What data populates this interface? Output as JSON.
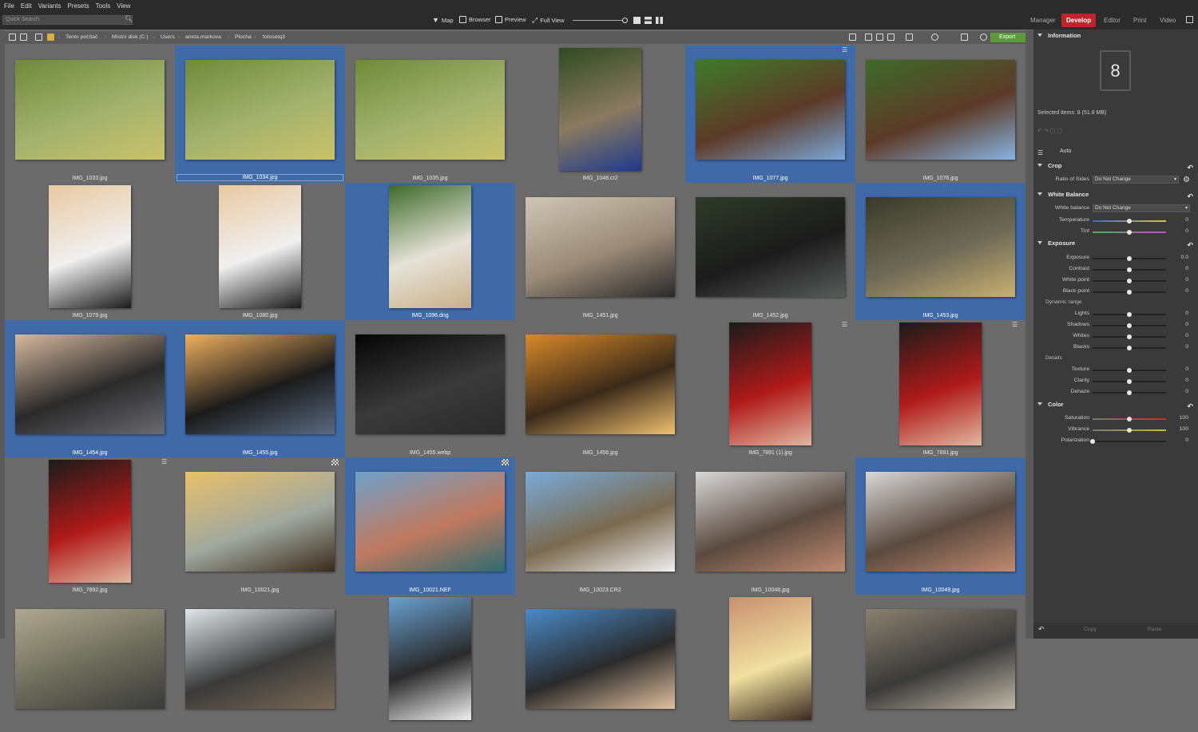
{
  "menu": [
    "File",
    "Edit",
    "Variants",
    "Presets",
    "Tools",
    "View"
  ],
  "search": {
    "placeholder": "Quick Search"
  },
  "view_tabs": [
    {
      "label": "Map",
      "icon": "map-pin-icon"
    },
    {
      "label": "Browser",
      "icon": "folder-icon"
    },
    {
      "label": "Preview",
      "icon": "image-icon"
    },
    {
      "label": "Full View",
      "icon": "expand-icon"
    }
  ],
  "mode_tabs": [
    "Manager",
    "Develop",
    "Editor",
    "Print",
    "Video"
  ],
  "active_mode": "Develop",
  "breadcrumb": [
    "Tento počítač",
    "Místní disk (C:)",
    "Users",
    "aneta.markova",
    "Plocha",
    "fotosetq3"
  ],
  "export_label": "Export",
  "colors": {
    "accent": "#b8282a",
    "selection": "#3f6aa7",
    "export": "#5c9a3c"
  },
  "thumbnails": [
    {
      "name": "IMG_1033.jpg",
      "selected": false,
      "orient": "land",
      "palette": [
        "#6f8a3a",
        "#c9c36a",
        "#a3b26e"
      ]
    },
    {
      "name": "IMG_1034.jpg",
      "selected": true,
      "focused": true,
      "orient": "land",
      "palette": [
        "#6f8a3a",
        "#c9c36a",
        "#a3b26e"
      ]
    },
    {
      "name": "IMG_1035.jpg",
      "selected": false,
      "orient": "land",
      "palette": [
        "#6f8a3a",
        "#c9c36a",
        "#a3b26e"
      ]
    },
    {
      "name": "IMG_1048.cr2",
      "selected": false,
      "orient": "port",
      "palette": [
        "#2f4a22",
        "#1f3a8a",
        "#8a7a60"
      ]
    },
    {
      "name": "IMG_1077.jpg",
      "selected": true,
      "orient": "land",
      "palette": [
        "#3f7a2a",
        "#7ba8d8",
        "#5c3a28"
      ],
      "badge": "menu"
    },
    {
      "name": "IMG_1078.jpg",
      "selected": false,
      "orient": "land",
      "palette": [
        "#3f6a2a",
        "#87b4e0",
        "#5c3a28"
      ]
    },
    {
      "name": "IMG_1079.jpg",
      "selected": false,
      "orient": "port",
      "palette": [
        "#e8c9a0",
        "#1b1b1b",
        "#f0f0f0"
      ]
    },
    {
      "name": "IMG_1080.jpg",
      "selected": false,
      "orient": "port",
      "palette": [
        "#e8c9a0",
        "#1b1b1b",
        "#f0f0f0"
      ]
    },
    {
      "name": "IMG_1096.dng",
      "selected": true,
      "orient": "port",
      "palette": [
        "#3d6a2a",
        "#c8b08a",
        "#e6e2d8"
      ]
    },
    {
      "name": "IMG_1451.jpg",
      "selected": false,
      "orient": "land",
      "palette": [
        "#cfc6b6",
        "#2a2a2a",
        "#9a8a78"
      ]
    },
    {
      "name": "IMG_1452.jpg",
      "selected": false,
      "orient": "land",
      "palette": [
        "#2f3a2a",
        "#595c5a",
        "#1b1b1b"
      ]
    },
    {
      "name": "IMG_1453.jpg",
      "selected": true,
      "orient": "land",
      "palette": [
        "#3a3a2a",
        "#c8b070",
        "#6f6a58"
      ]
    },
    {
      "name": "IMG_1454.jpg",
      "selected": true,
      "orient": "land",
      "palette": [
        "#d6b9a0",
        "#6a6a70",
        "#2a2a2a"
      ]
    },
    {
      "name": "IMG_1455.jpg",
      "selected": true,
      "orient": "land",
      "palette": [
        "#f0b060",
        "#5a6a80",
        "#1b1b1b"
      ]
    },
    {
      "name": "IMG_1455.webp",
      "selected": false,
      "orient": "land",
      "palette": [
        "#050505",
        "#2a2a2a",
        "#3a3a3a"
      ]
    },
    {
      "name": "IMG_1456.jpg",
      "selected": false,
      "orient": "land",
      "palette": [
        "#d88a2a",
        "#f0c070",
        "#3a2a1a"
      ]
    },
    {
      "name": "IMG_7891 (1).jpg",
      "selected": false,
      "orient": "port",
      "palette": [
        "#1b1b1b",
        "#e0b8a0",
        "#b01a1a"
      ],
      "badge": "menu"
    },
    {
      "name": "IMG_7891.jpg",
      "selected": false,
      "orient": "port",
      "palette": [
        "#1b1b1b",
        "#e0b8a0",
        "#b01a1a"
      ],
      "badge": "menu"
    },
    {
      "name": "IMG_7892.jpg",
      "selected": false,
      "orient": "port",
      "palette": [
        "#1b1b1b",
        "#e0b8a0",
        "#b01a1a"
      ],
      "badge": "menu"
    },
    {
      "name": "IMG_10021.jpg",
      "selected": false,
      "orient": "land",
      "palette": [
        "#e8c06a",
        "#3a2a1a",
        "#a0a8a0"
      ],
      "badge": "checker"
    },
    {
      "name": "IMG_10021.NEF",
      "selected": true,
      "orient": "land",
      "palette": [
        "#6fa0c8",
        "#2f6a70",
        "#c07a60"
      ],
      "badge": "checker"
    },
    {
      "name": "IMG_10023.CR2",
      "selected": false,
      "orient": "land",
      "palette": [
        "#7aaad8",
        "#f0f0f0",
        "#7a6a50"
      ]
    },
    {
      "name": "IMG_10048.jpg",
      "selected": false,
      "orient": "land",
      "palette": [
        "#d8d8d8",
        "#c08a70",
        "#5a4a40"
      ]
    },
    {
      "name": "IMG_10049.jpg",
      "selected": true,
      "orient": "land",
      "palette": [
        "#d8d8d8",
        "#c08a70",
        "#5a4a40"
      ]
    },
    {
      "name": "",
      "selected": false,
      "orient": "land",
      "palette": [
        "#b0a890",
        "#3a3a3a",
        "#6a6a5a"
      ]
    },
    {
      "name": "",
      "selected": false,
      "orient": "land",
      "palette": [
        "#e0e6ea",
        "#7a6a58",
        "#3a3a3a"
      ]
    },
    {
      "name": "",
      "selected": false,
      "orient": "port",
      "palette": [
        "#6aa0d0",
        "#f0f0f0",
        "#2a2a2a"
      ]
    },
    {
      "name": "",
      "selected": false,
      "orient": "land",
      "palette": [
        "#4a8ac8",
        "#e0c0a0",
        "#2a2a2a"
      ]
    },
    {
      "name": "",
      "selected": false,
      "orient": "port",
      "palette": [
        "#c89070",
        "#3a2a20",
        "#f0e0a0"
      ]
    },
    {
      "name": "",
      "selected": false,
      "orient": "land",
      "palette": [
        "#8a8070",
        "#c0b8a8",
        "#3a3a3a"
      ]
    }
  ],
  "panel": {
    "information_title": "Information",
    "selected_count_big": "8",
    "selected_items": "Selected items: 8 (51.8 MB)",
    "auto_label": "Auto",
    "crop": {
      "title": "Crop",
      "ratio_label": "Ratio of Sides",
      "ratio_value": "Do Not Change"
    },
    "white_balance": {
      "title": "White Balance",
      "wb_label": "White balance",
      "wb_value": "Do Not Change",
      "sliders": [
        {
          "label": "Temperature",
          "value": "0",
          "pos": 0.5
        },
        {
          "label": "Tint",
          "value": "0",
          "pos": 0.5
        }
      ]
    },
    "exposure": {
      "title": "Exposure",
      "sliders": [
        {
          "label": "Exposure",
          "value": "0.0",
          "pos": 0.5
        },
        {
          "label": "Contrast",
          "value": "0",
          "pos": 0.5
        },
        {
          "label": "White point",
          "value": "0",
          "pos": 0.5
        },
        {
          "label": "Black point",
          "value": "0",
          "pos": 0.5
        }
      ],
      "dynamic_range_label": "Dynamic range",
      "dynamic_sliders": [
        {
          "label": "Lights",
          "value": "0",
          "pos": 0.5
        },
        {
          "label": "Shadows",
          "value": "0",
          "pos": 0.5
        },
        {
          "label": "Whites",
          "value": "0",
          "pos": 0.5
        },
        {
          "label": "Blacks",
          "value": "0",
          "pos": 0.5
        }
      ],
      "details_label": "Details",
      "detail_sliders": [
        {
          "label": "Texture",
          "value": "0",
          "pos": 0.5
        },
        {
          "label": "Clarity",
          "value": "0",
          "pos": 0.5
        },
        {
          "label": "Dehaze",
          "value": "0",
          "pos": 0.5
        }
      ]
    },
    "color": {
      "title": "Color",
      "sliders": [
        {
          "label": "Saturation",
          "value": "100",
          "pos": 0.5
        },
        {
          "label": "Vibrance",
          "value": "100",
          "pos": 0.5
        },
        {
          "label": "Polarization",
          "value": "0",
          "pos": 0.0
        }
      ]
    },
    "copy_label": "Copy",
    "paste_label": "Paste"
  }
}
